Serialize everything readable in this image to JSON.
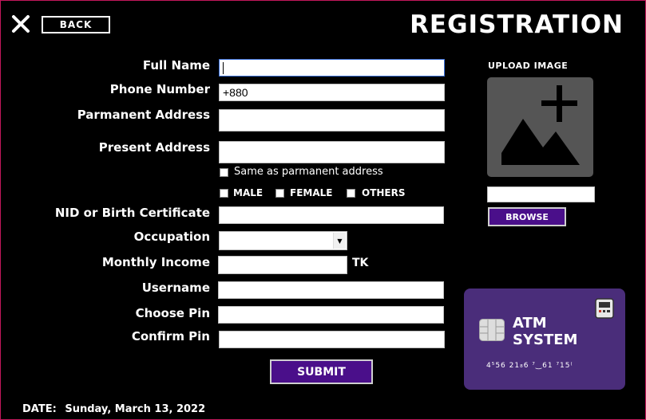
{
  "header": {
    "back_label": "BACK",
    "title": "REGISTRATION"
  },
  "form": {
    "full_name": {
      "label": "Full Name",
      "value": ""
    },
    "phone_number": {
      "label": "Phone Number",
      "value": "+880"
    },
    "permanent_address": {
      "label": "Parmanent Address",
      "value": ""
    },
    "present_address": {
      "label": "Present Address",
      "value": ""
    },
    "same_as_permanent": {
      "label": "Same as parmanent address",
      "checked": false
    },
    "gender": {
      "options": [
        {
          "label": "MALE",
          "checked": false
        },
        {
          "label": "FEMALE",
          "checked": false
        },
        {
          "label": "OTHERS",
          "checked": false
        }
      ]
    },
    "nid": {
      "label": "NID or Birth Certificate",
      "value": ""
    },
    "occupation": {
      "label": "Occupation",
      "value": ""
    },
    "monthly_income": {
      "label": "Monthly Income",
      "value": "",
      "unit": "TK"
    },
    "username": {
      "label": "Username",
      "value": ""
    },
    "choose_pin": {
      "label": "Choose Pin",
      "value": ""
    },
    "confirm_pin": {
      "label": "Confirm Pin",
      "value": ""
    },
    "submit_label": "SUBMIT"
  },
  "upload": {
    "label": "UPLOAD IMAGE",
    "path_value": "",
    "browse_label": "BROWSE"
  },
  "atm_card": {
    "title_line1": "ATM",
    "title_line2": "SYSTEM",
    "card_number": "4⁵56  21₈6  ⁷‿61  ⁷15⁽",
    "color": "#4a2d7a"
  },
  "footer": {
    "date_label": "DATE:",
    "date_value": "Sunday, March 13, 2022"
  },
  "colors": {
    "background": "#000000",
    "accent_purple": "#4a0f8a",
    "border_pink": "#c2185b"
  }
}
